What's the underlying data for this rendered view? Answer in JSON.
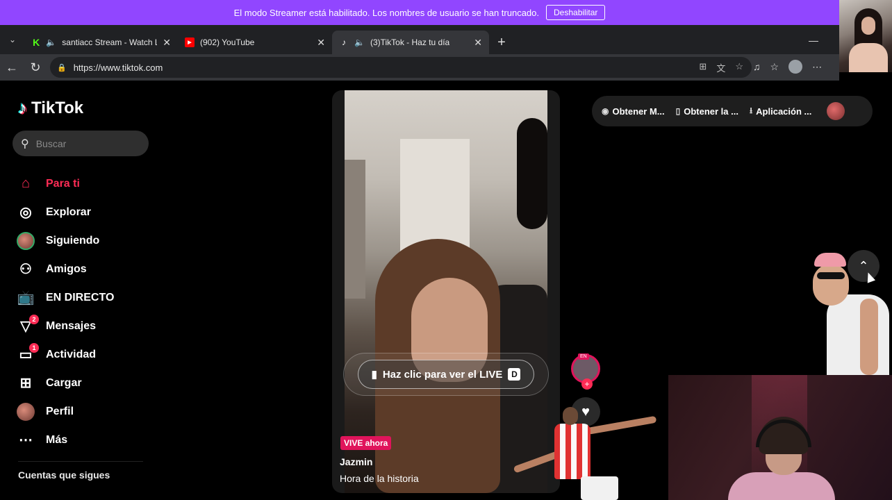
{
  "streamer_banner": {
    "message": "El modo Streamer está habilitado. Los nombres de usuario se han truncado.",
    "button": "Deshabilitar"
  },
  "browser": {
    "tabs": [
      {
        "title": "santiacc Stream - Watch Live",
        "favicon_color": "#53fc18"
      },
      {
        "title": "(902) YouTube",
        "favicon_color": "#ff0000"
      },
      {
        "title": "(3)TikTok - Haz tu día",
        "favicon_color": "#000000"
      }
    ],
    "url": "https://www.tiktok.com"
  },
  "sidebar": {
    "logo_text": "TikTok",
    "search_placeholder": "Buscar",
    "items": [
      {
        "label": "Para ti",
        "icon": "home-icon",
        "active": true
      },
      {
        "label": "Explorar",
        "icon": "compass-icon"
      },
      {
        "label": "Siguiendo",
        "icon": "following-avatar-icon"
      },
      {
        "label": "Amigos",
        "icon": "friends-icon"
      },
      {
        "label": "EN DIRECTO",
        "icon": "live-tv-icon"
      },
      {
        "label": "Mensajes",
        "icon": "messages-icon",
        "badge": "2"
      },
      {
        "label": "Actividad",
        "icon": "activity-icon",
        "badge": "1"
      },
      {
        "label": "Cargar",
        "icon": "upload-icon"
      },
      {
        "label": "Perfil",
        "icon": "profile-avatar-icon"
      },
      {
        "label": "Más",
        "icon": "more-icon"
      }
    ],
    "following_header": "Cuentas que sigues"
  },
  "video": {
    "live_button": "Haz clic para ver el LIVE",
    "live_key": "D",
    "live_badge": "VIVE ahora",
    "author": "Jazmin",
    "description": "Hora de la historia",
    "avatar_tag": "EN"
  },
  "top_actions": [
    {
      "label": "Obtener M...",
      "icon": "coin-icon"
    },
    {
      "label": "Obtener la ...",
      "icon": "phone-icon"
    },
    {
      "label": "Aplicación ...",
      "icon": "download-icon"
    }
  ],
  "colors": {
    "tiktok_pink": "#fe2c55",
    "streamer_purple": "#9146ff"
  }
}
